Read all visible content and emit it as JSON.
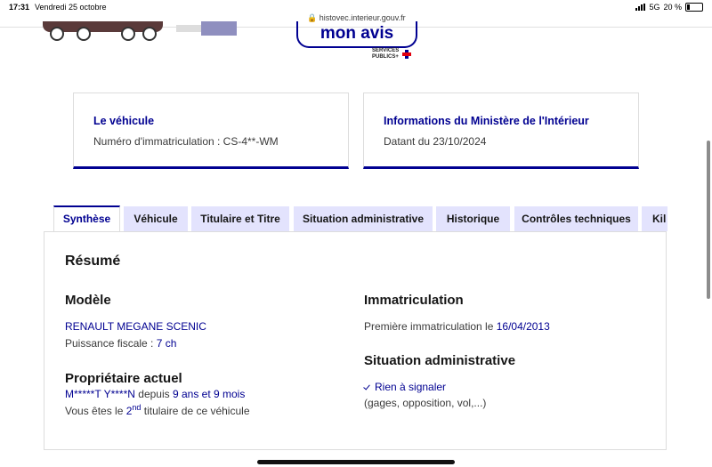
{
  "status_bar": {
    "time": "17:31",
    "date": "Vendredi 25 octobre",
    "url": "histovec.interieur.gouv.fr",
    "network": "5G",
    "battery": "20 %"
  },
  "header": {
    "avis_button": "mon avis",
    "services_publics_line1": "SERVICES",
    "services_publics_line2": "PUBLICS+"
  },
  "cards": {
    "vehicle": {
      "title": "Le véhicule",
      "text": "Numéro d'immatriculation : CS-4**-WM"
    },
    "ministry": {
      "title": "Informations du Ministère de l'Intérieur",
      "text": "Datant du 23/10/2024"
    }
  },
  "tabs": [
    {
      "label": "Synthèse"
    },
    {
      "label": "Véhicule"
    },
    {
      "label": "Titulaire et Titre"
    },
    {
      "label": "Situation administrative"
    },
    {
      "label": "Historique"
    },
    {
      "label": "Contrôles techniques"
    },
    {
      "label": "Kil"
    }
  ],
  "summary": {
    "title": "Résumé",
    "model": {
      "heading": "Modèle",
      "name": "RENAULT MEGANE SCENIC",
      "power_label": "Puissance fiscale : ",
      "power_value": "7 ch"
    },
    "owner": {
      "heading": "Propriétaire actuel",
      "name": "M*****T Y****N",
      "since_label": " depuis ",
      "since_value": "9 ans et 9 mois",
      "rank_prefix": "Vous êtes le ",
      "rank_number": "2",
      "rank_suffix": "nd",
      "rank_end": " titulaire de ce véhicule"
    },
    "registration": {
      "heading": "Immatriculation",
      "label": "Première immatriculation le ",
      "date": "16/04/2013"
    },
    "admin": {
      "heading": "Situation administrative",
      "status": "Rien à signaler",
      "detail": "(gages, opposition, vol,...)"
    }
  },
  "colors": {
    "primary_blue": "#000091",
    "tab_background": "#e3e3fd"
  }
}
